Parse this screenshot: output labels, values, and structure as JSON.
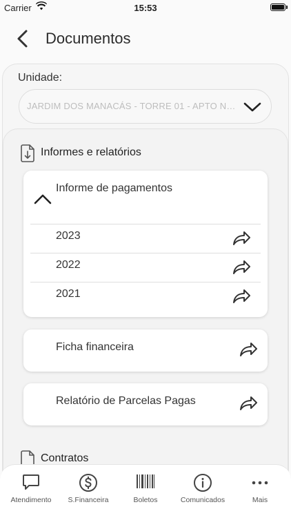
{
  "status": {
    "carrier": "Carrier",
    "time": "15:53"
  },
  "header": {
    "title": "Documentos"
  },
  "unidade": {
    "label": "Unidade:",
    "selected": "JARDIM DOS MANACÁS - TORRE 01 - APTO Nº..."
  },
  "informes": {
    "title": "Informes e relatórios",
    "accordion": {
      "title": "Informe de pagamentos",
      "expanded": true,
      "years": [
        "2023",
        "2022",
        "2021"
      ]
    },
    "ficha": "Ficha financeira",
    "parcelas": "Relatório de Parcelas Pagas"
  },
  "contratos": {
    "title": "Contratos"
  },
  "tabbar": {
    "items": [
      {
        "label": "Atendimento",
        "icon": "chat-icon"
      },
      {
        "label": "S.Financeira",
        "icon": "dollar-circle-icon"
      },
      {
        "label": "Boletos",
        "icon": "barcode-icon"
      },
      {
        "label": "Comunicados",
        "icon": "info-circle-icon"
      },
      {
        "label": "Mais",
        "icon": "more-dots-icon"
      }
    ]
  },
  "colors": {
    "icon": "#444444",
    "accent_text": "#222222",
    "placeholder": "#bdbdbd"
  }
}
